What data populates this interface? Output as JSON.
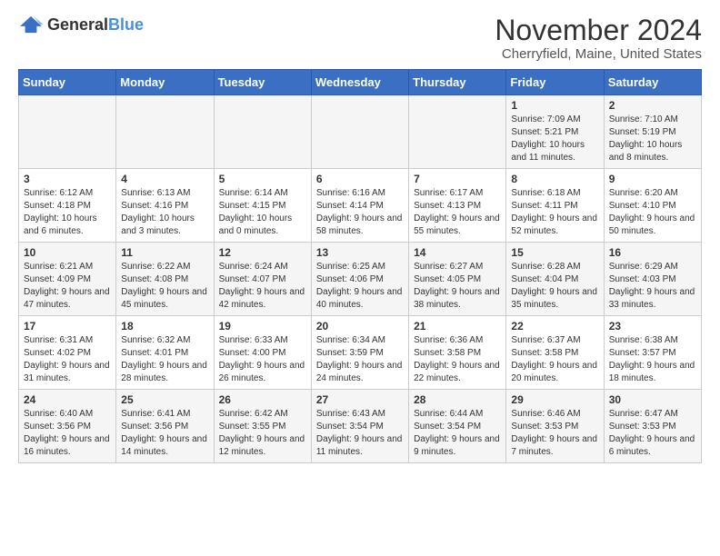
{
  "logo": {
    "general": "General",
    "blue": "Blue"
  },
  "title": "November 2024",
  "subtitle": "Cherryfield, Maine, United States",
  "days_header": [
    "Sunday",
    "Monday",
    "Tuesday",
    "Wednesday",
    "Thursday",
    "Friday",
    "Saturday"
  ],
  "weeks": [
    [
      {
        "day": "",
        "info": ""
      },
      {
        "day": "",
        "info": ""
      },
      {
        "day": "",
        "info": ""
      },
      {
        "day": "",
        "info": ""
      },
      {
        "day": "",
        "info": ""
      },
      {
        "day": "1",
        "info": "Sunrise: 7:09 AM\nSunset: 5:21 PM\nDaylight: 10 hours and 11 minutes."
      },
      {
        "day": "2",
        "info": "Sunrise: 7:10 AM\nSunset: 5:19 PM\nDaylight: 10 hours and 8 minutes."
      }
    ],
    [
      {
        "day": "3",
        "info": "Sunrise: 6:12 AM\nSunset: 4:18 PM\nDaylight: 10 hours and 6 minutes."
      },
      {
        "day": "4",
        "info": "Sunrise: 6:13 AM\nSunset: 4:16 PM\nDaylight: 10 hours and 3 minutes."
      },
      {
        "day": "5",
        "info": "Sunrise: 6:14 AM\nSunset: 4:15 PM\nDaylight: 10 hours and 0 minutes."
      },
      {
        "day": "6",
        "info": "Sunrise: 6:16 AM\nSunset: 4:14 PM\nDaylight: 9 hours and 58 minutes."
      },
      {
        "day": "7",
        "info": "Sunrise: 6:17 AM\nSunset: 4:13 PM\nDaylight: 9 hours and 55 minutes."
      },
      {
        "day": "8",
        "info": "Sunrise: 6:18 AM\nSunset: 4:11 PM\nDaylight: 9 hours and 52 minutes."
      },
      {
        "day": "9",
        "info": "Sunrise: 6:20 AM\nSunset: 4:10 PM\nDaylight: 9 hours and 50 minutes."
      }
    ],
    [
      {
        "day": "10",
        "info": "Sunrise: 6:21 AM\nSunset: 4:09 PM\nDaylight: 9 hours and 47 minutes."
      },
      {
        "day": "11",
        "info": "Sunrise: 6:22 AM\nSunset: 4:08 PM\nDaylight: 9 hours and 45 minutes."
      },
      {
        "day": "12",
        "info": "Sunrise: 6:24 AM\nSunset: 4:07 PM\nDaylight: 9 hours and 42 minutes."
      },
      {
        "day": "13",
        "info": "Sunrise: 6:25 AM\nSunset: 4:06 PM\nDaylight: 9 hours and 40 minutes."
      },
      {
        "day": "14",
        "info": "Sunrise: 6:27 AM\nSunset: 4:05 PM\nDaylight: 9 hours and 38 minutes."
      },
      {
        "day": "15",
        "info": "Sunrise: 6:28 AM\nSunset: 4:04 PM\nDaylight: 9 hours and 35 minutes."
      },
      {
        "day": "16",
        "info": "Sunrise: 6:29 AM\nSunset: 4:03 PM\nDaylight: 9 hours and 33 minutes."
      }
    ],
    [
      {
        "day": "17",
        "info": "Sunrise: 6:31 AM\nSunset: 4:02 PM\nDaylight: 9 hours and 31 minutes."
      },
      {
        "day": "18",
        "info": "Sunrise: 6:32 AM\nSunset: 4:01 PM\nDaylight: 9 hours and 28 minutes."
      },
      {
        "day": "19",
        "info": "Sunrise: 6:33 AM\nSunset: 4:00 PM\nDaylight: 9 hours and 26 minutes."
      },
      {
        "day": "20",
        "info": "Sunrise: 6:34 AM\nSunset: 3:59 PM\nDaylight: 9 hours and 24 minutes."
      },
      {
        "day": "21",
        "info": "Sunrise: 6:36 AM\nSunset: 3:58 PM\nDaylight: 9 hours and 22 minutes."
      },
      {
        "day": "22",
        "info": "Sunrise: 6:37 AM\nSunset: 3:58 PM\nDaylight: 9 hours and 20 minutes."
      },
      {
        "day": "23",
        "info": "Sunrise: 6:38 AM\nSunset: 3:57 PM\nDaylight: 9 hours and 18 minutes."
      }
    ],
    [
      {
        "day": "24",
        "info": "Sunrise: 6:40 AM\nSunset: 3:56 PM\nDaylight: 9 hours and 16 minutes."
      },
      {
        "day": "25",
        "info": "Sunrise: 6:41 AM\nSunset: 3:56 PM\nDaylight: 9 hours and 14 minutes."
      },
      {
        "day": "26",
        "info": "Sunrise: 6:42 AM\nSunset: 3:55 PM\nDaylight: 9 hours and 12 minutes."
      },
      {
        "day": "27",
        "info": "Sunrise: 6:43 AM\nSunset: 3:54 PM\nDaylight: 9 hours and 11 minutes."
      },
      {
        "day": "28",
        "info": "Sunrise: 6:44 AM\nSunset: 3:54 PM\nDaylight: 9 hours and 9 minutes."
      },
      {
        "day": "29",
        "info": "Sunrise: 6:46 AM\nSunset: 3:53 PM\nDaylight: 9 hours and 7 minutes."
      },
      {
        "day": "30",
        "info": "Sunrise: 6:47 AM\nSunset: 3:53 PM\nDaylight: 9 hours and 6 minutes."
      }
    ]
  ]
}
